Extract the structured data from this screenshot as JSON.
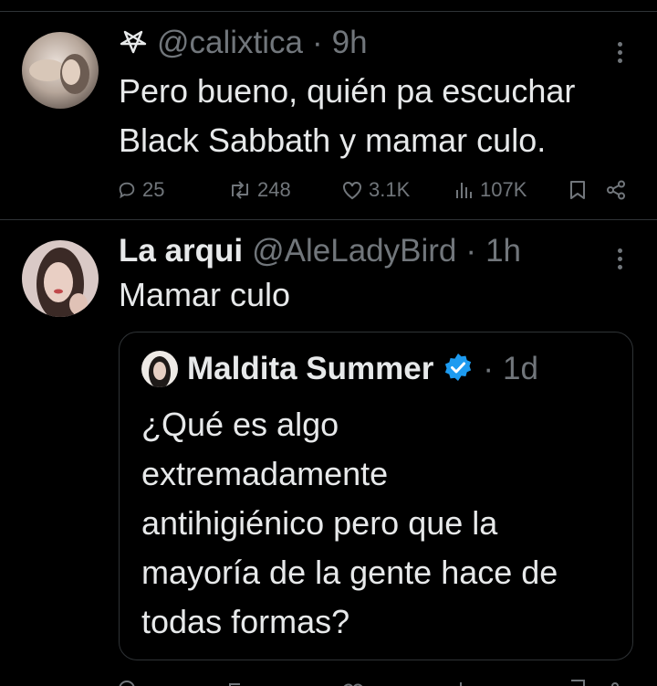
{
  "tweet1": {
    "handle": "@calixtica",
    "time": "9h",
    "text_line1": "Pero bueno, quién pa escuchar",
    "text_line2": "Black Sabbath y mamar culo.",
    "metrics": {
      "replies": "25",
      "retweets": "248",
      "likes": "3.1K",
      "views": "107K"
    }
  },
  "tweet2": {
    "name": "La arqui",
    "handle": "@AleLadyBird",
    "time": "1h",
    "text": "Mamar culo",
    "quote": {
      "name": "Maldita Summer",
      "time": "1d",
      "lines": [
        "¿Qué es algo",
        "extremadamente",
        "antihigiénico pero que la",
        "mayoría de la gente hace de",
        "todas formas?"
      ]
    }
  },
  "separator": "·",
  "icons": {
    "pentagram": "pentagram-icon",
    "more": "more-icon",
    "reply": "reply-icon",
    "retweet": "retweet-icon",
    "like": "like-icon",
    "views": "views-icon",
    "bookmark": "bookmark-icon",
    "share": "share-icon",
    "verified": "verified-badge-icon"
  },
  "colors": {
    "background": "#000000",
    "text": "#e7e9ea",
    "muted": "#71767b",
    "divider": "#2f3336",
    "verified": "#1d9bf0"
  }
}
